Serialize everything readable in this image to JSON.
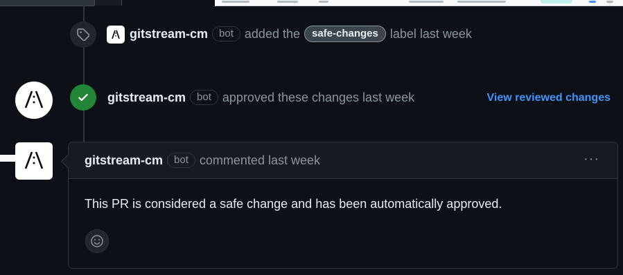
{
  "event_label": {
    "author": "gitstream-cm",
    "bot_tag": "bot",
    "action_before": "added the",
    "label": "safe-changes",
    "action_after": "label last week"
  },
  "event_approval": {
    "author": "gitstream-cm",
    "bot_tag": "bot",
    "action": "approved these changes last week",
    "view_link": "View reviewed changes"
  },
  "comment": {
    "author": "gitstream-cm",
    "bot_tag": "bot",
    "action": "commented last week",
    "menu": "···",
    "body": "This PR is considered a safe change and has been automatically approved."
  },
  "icons": {
    "tag": "tag-icon",
    "check": "check-icon",
    "avatar": "gitstream-logo-icon",
    "emoji": "smiley-icon",
    "kebab": "kebab-menu-icon"
  },
  "colors": {
    "background": "#0d1117",
    "approve_green": "#238636",
    "link_blue": "#4493f8",
    "muted": "#8b949e"
  }
}
